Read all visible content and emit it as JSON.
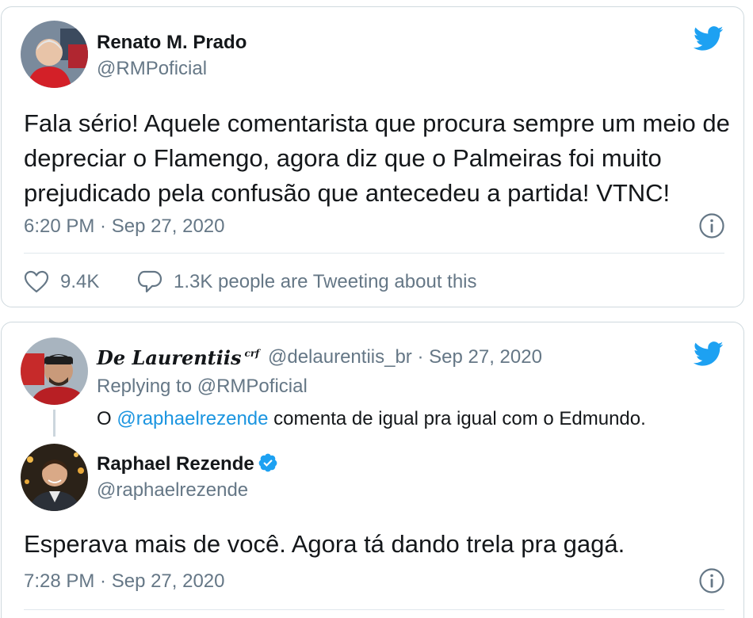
{
  "tweet1": {
    "name": "Renato M. Prado",
    "handle": "@RMPoficial",
    "text": "Fala sério! Aquele comentarista que procura sempre um meio de depreciar o Flamengo, agora diz que o Palmeiras foi muito prejudicado pela confusão que antecedeu a partida! VTNC!",
    "timestamp": "6:20 PM · Sep 27, 2020",
    "likes": "9.4K",
    "tweeting": "1.3K people are Tweeting about this"
  },
  "tweet2": {
    "reply": {
      "name": "De Laurentiis",
      "name_badge": "crf",
      "handle_date": "@delaurentiis_br · Sep 27, 2020",
      "replying_to": "Replying to @RMPoficial",
      "text_prefix": "O",
      "mention": "@raphaelrezende",
      "text_suffix": "comenta de igual pra igual com o Edmundo."
    },
    "name": "Raphael Rezende",
    "handle": "@raphaelrezende",
    "text": "Esperava mais de você. Agora tá dando trela pra gagá.",
    "timestamp": "7:28 PM · Sep 27, 2020"
  },
  "colors": {
    "twitter_blue": "#1da1f2",
    "link_blue": "#1b95e0",
    "secondary_text": "#657786",
    "border": "#cfd9de"
  }
}
